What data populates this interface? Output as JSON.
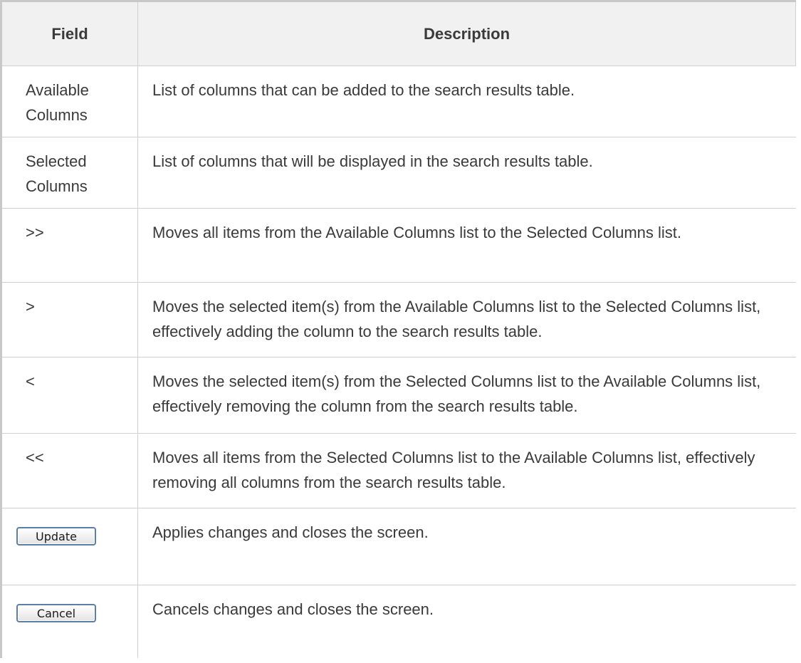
{
  "table": {
    "header": {
      "field": "Field",
      "description": "Description"
    },
    "rows": [
      {
        "field": "Available Columns",
        "description": "List of columns that can be added to the search results table."
      },
      {
        "field": "Selected Columns",
        "description": "List of columns that will be displayed in the search results table."
      },
      {
        "field": ">>",
        "description": "Moves all items from the Available Columns list to the Selected Columns list."
      },
      {
        "field": ">",
        "description": "Moves the selected item(s) from the Available Columns list to the Selected Columns list, effectively adding the column to the search results table."
      },
      {
        "field": "<",
        "description": "Moves the selected item(s) from the Selected Columns list to the Available Columns list, effectively removing the column from the search results table."
      },
      {
        "field": "<<",
        "description": "Moves all items from the Selected Columns list to the Available Columns list, effectively removing all columns from the search results table."
      },
      {
        "field_button": "Update",
        "description": "Applies changes and closes the screen."
      },
      {
        "field_button": "Cancel",
        "description": "Cancels changes and closes the screen."
      }
    ]
  },
  "colors": {
    "header_background": "#f1f1f1",
    "text": "#3a3a3a",
    "button_border": "#5b7fa6"
  }
}
